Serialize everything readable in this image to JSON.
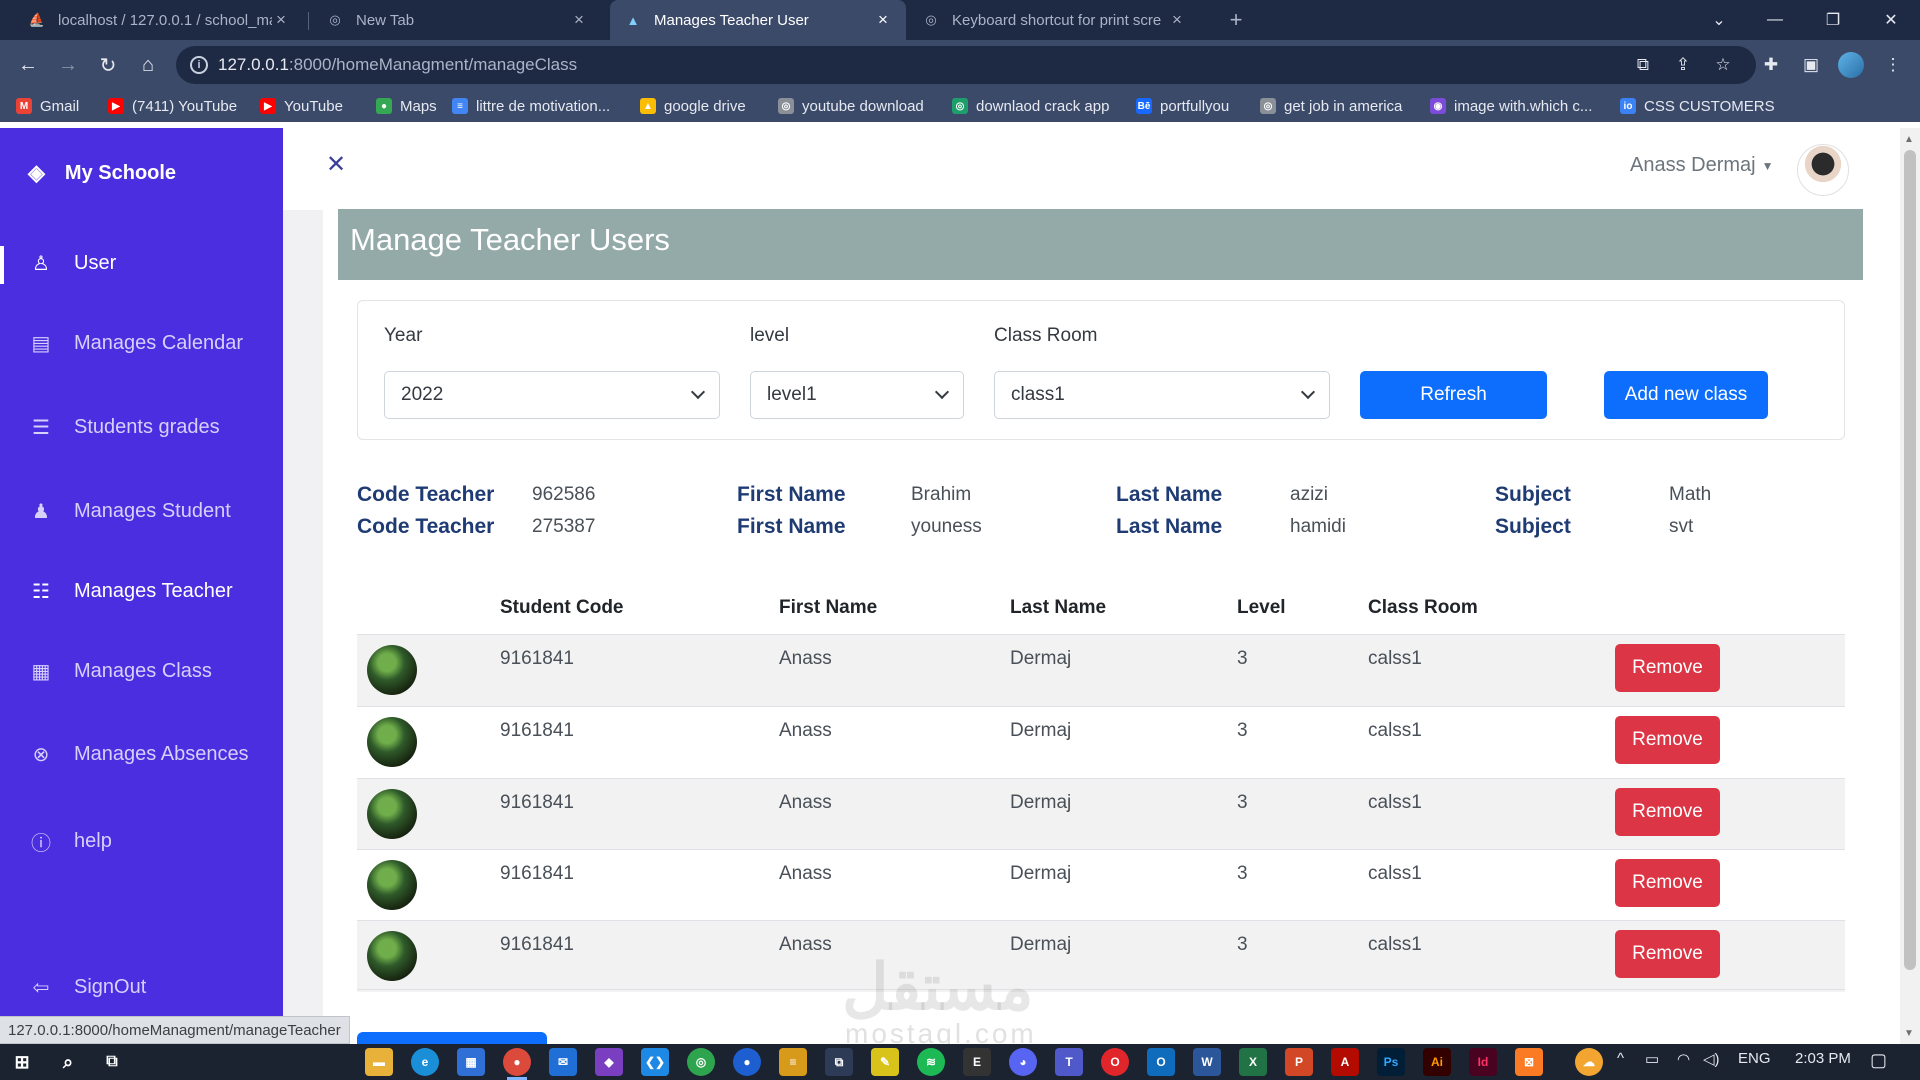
{
  "browser": {
    "tabs": [
      {
        "title": "localhost / 127.0.0.1 / school_ma",
        "icon": "phpmyadmin-icon",
        "active": false
      },
      {
        "title": "New Tab",
        "icon": "chrome-icon",
        "active": false
      },
      {
        "title": "Manages Teacher User",
        "icon": "school-icon",
        "active": true
      },
      {
        "title": "Keyboard shortcut for print scre",
        "icon": "globe-icon",
        "active": false
      }
    ],
    "url_host": "127.0.0.1",
    "url_path": ":8000/homeManagment/manageClass",
    "bookmarks": [
      {
        "label": "Gmail",
        "color": "#ea4335",
        "glyph": "M"
      },
      {
        "label": "(7411) YouTube",
        "color": "#ff0000",
        "glyph": "▶"
      },
      {
        "label": "YouTube",
        "color": "#ff0000",
        "glyph": "▶"
      },
      {
        "label": "Maps",
        "color": "#34a853",
        "glyph": "●"
      },
      {
        "label": "littre de motivation...",
        "color": "#4285f4",
        "glyph": "≡"
      },
      {
        "label": "google drive",
        "color": "#fbbc04",
        "glyph": "▲"
      },
      {
        "label": "youtube download",
        "color": "#8a8f98",
        "glyph": "◎"
      },
      {
        "label": "downlaod crack app",
        "color": "#1e9e6a",
        "glyph": "◎"
      },
      {
        "label": "portfullyou",
        "color": "#1769ff",
        "glyph": "Bē"
      },
      {
        "label": "get job in america",
        "color": "#8a8f98",
        "glyph": "◎"
      },
      {
        "label": "image with.which c...",
        "color": "#7b4bd9",
        "glyph": "◉"
      },
      {
        "label": "CSS CUSTOMERS",
        "color": "#3b82f6",
        "glyph": "io"
      }
    ],
    "status_tip": "127.0.0.1:8000/homeManagment/manageTeacher"
  },
  "sidebar": {
    "brand": "My Schoole",
    "items": [
      {
        "label": "User",
        "icon": "user-icon"
      },
      {
        "label": "Manages Calendar",
        "icon": "calendar-icon"
      },
      {
        "label": "Students grades",
        "icon": "grades-icon"
      },
      {
        "label": "Manages Student",
        "icon": "student-icon"
      },
      {
        "label": "Manages Teacher",
        "icon": "teacher-icon"
      },
      {
        "label": "Manages Class",
        "icon": "class-icon"
      },
      {
        "label": "Manages Absences",
        "icon": "absence-icon"
      },
      {
        "label": "help",
        "icon": "info-icon"
      },
      {
        "label": "SignOut",
        "icon": "signout-icon"
      }
    ]
  },
  "header": {
    "user_name": "Anass Dermaj"
  },
  "page": {
    "title": "Manage Teacher Users"
  },
  "filters": {
    "year_label": "Year",
    "year_value": "2022",
    "level_label": "level",
    "level_value": "level1",
    "class_label": "Class Room",
    "class_value": "class1",
    "refresh_label": "Refresh",
    "add_label": "Add new class"
  },
  "teachers": [
    {
      "code_label": "Code Teacher",
      "code": "962586",
      "first_label": "First Name",
      "first": "Brahim",
      "last_label": "Last Name",
      "last": "azizi",
      "subject_label": "Subject",
      "subject": "Math"
    },
    {
      "code_label": "Code Teacher",
      "code": "275387",
      "first_label": "First Name",
      "first": "youness",
      "last_label": "Last Name",
      "last": "hamidi",
      "subject_label": "Subject",
      "subject": "svt"
    }
  ],
  "table": {
    "headers": [
      "Student Code",
      "First Name",
      "Last Name",
      "Level",
      "Class Room"
    ],
    "rows": [
      {
        "code": "9161841",
        "first": "Anass",
        "last": "Dermaj",
        "level": "3",
        "room": "calss1",
        "action": "Remove"
      },
      {
        "code": "9161841",
        "first": "Anass",
        "last": "Dermaj",
        "level": "3",
        "room": "calss1",
        "action": "Remove"
      },
      {
        "code": "9161841",
        "first": "Anass",
        "last": "Dermaj",
        "level": "3",
        "room": "calss1",
        "action": "Remove"
      },
      {
        "code": "9161841",
        "first": "Anass",
        "last": "Dermaj",
        "level": "3",
        "room": "calss1",
        "action": "Remove"
      },
      {
        "code": "9161841",
        "first": "Anass",
        "last": "Dermaj",
        "level": "3",
        "room": "calss1",
        "action": "Remove"
      }
    ]
  },
  "watermark": {
    "arabic": "مستقل",
    "latin": "mostaql.com"
  },
  "taskbar": {
    "lang": "ENG",
    "time": "2:03 PM"
  },
  "colors": {
    "sidebar": "#4a2ee0",
    "banner": "#93aaa8",
    "primary": "#0d6efd",
    "danger": "#dc3545"
  }
}
